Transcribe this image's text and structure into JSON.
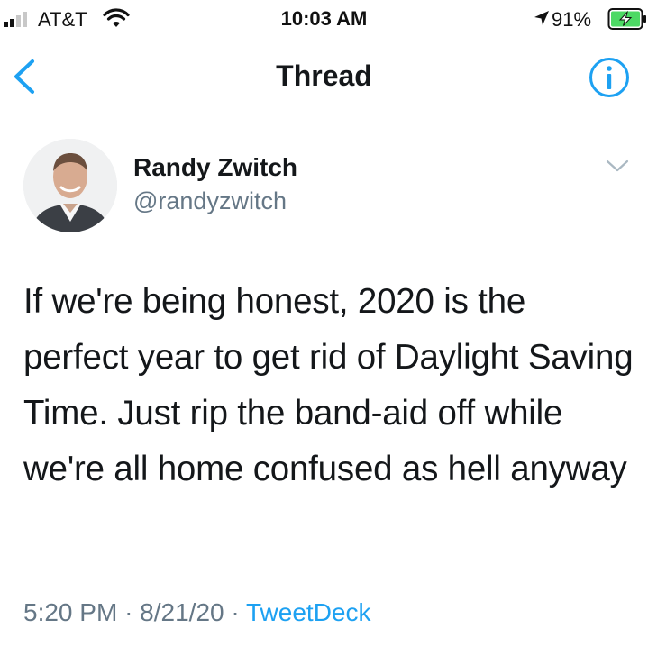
{
  "status_bar": {
    "carrier": "AT&T",
    "time": "10:03 AM",
    "battery": "91%"
  },
  "nav": {
    "title": "Thread"
  },
  "tweet": {
    "author_name": "Randy Zwitch",
    "author_handle": "@randyzwitch",
    "text": "If we're being honest, 2020 is the perfect year to get rid of Daylight Saving Time. Just rip the band-aid off while we're all home confused as hell anyway",
    "time": "5:20 PM",
    "separator": "·",
    "date": "8/21/20",
    "source": "TweetDeck"
  },
  "colors": {
    "accent": "#1da1f2",
    "secondary_text": "#657786",
    "battery_green": "#4cd964"
  },
  "icons": [
    "signal-icon",
    "wifi-icon",
    "location-arrow-icon",
    "battery-icon",
    "back-chevron-icon",
    "info-icon",
    "chevron-down-icon"
  ]
}
